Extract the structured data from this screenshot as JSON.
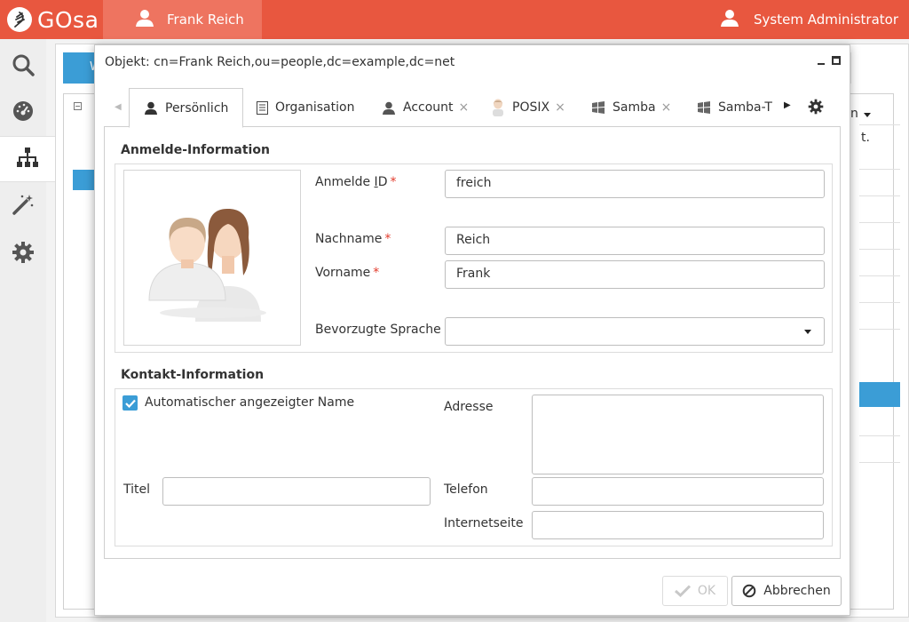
{
  "topbar": {
    "logo_text": "GOsa",
    "current_user": "Frank Reich",
    "admin_user": "System Administrator",
    "color": "#e8573f"
  },
  "sidebar": {
    "items": [
      {
        "name": "search",
        "icon": "search-icon"
      },
      {
        "name": "dashboard",
        "icon": "dashboard-icon"
      },
      {
        "name": "directory",
        "icon": "sitemap-icon",
        "active": true
      },
      {
        "name": "wizard",
        "icon": "magic-wand-icon"
      },
      {
        "name": "settings",
        "icon": "gear-icon"
      }
    ]
  },
  "background": {
    "button_fragment": "W",
    "dropdown_fragment": "n",
    "row_fragment": "t."
  },
  "dialog": {
    "title": "Objekt: cn=Frank Reich,ou=people,dc=example,dc=net",
    "tabs": [
      {
        "label": "Persönlich",
        "icon": "user-icon",
        "active": true,
        "closable": false
      },
      {
        "label": "Organisation",
        "icon": "building-icon",
        "active": false,
        "closable": false
      },
      {
        "label": "Account",
        "icon": "user-icon",
        "active": false,
        "closable": true
      },
      {
        "label": "POSIX",
        "icon": "penguin-icon",
        "active": false,
        "closable": true
      },
      {
        "label": "Samba",
        "icon": "windows-icon",
        "active": false,
        "closable": true
      },
      {
        "label": "Samba-T",
        "icon": "windows-icon",
        "active": false,
        "closable": false
      }
    ],
    "login_section": {
      "title": "Anmelde-Information",
      "login_id_label_pre": "Anmelde ",
      "login_id_label_key": "I",
      "login_id_label_post": "D",
      "login_id_value": "freich",
      "surname_label": "Nachname",
      "surname_value": "Reich",
      "firstname_label": "Vorname",
      "firstname_value": "Frank",
      "language_label": "Bevorzugte Sprache",
      "language_value": "",
      "required_marker": "*"
    },
    "contact_section": {
      "title": "Kontakt-Information",
      "auto_display_name_label": "Automatischer angezeigter Name",
      "auto_display_name_checked": true,
      "title_label": "Titel",
      "title_value": "",
      "address_label": "Adresse",
      "address_value": "",
      "phone_label": "Telefon",
      "phone_value": "",
      "website_label": "Internetseite",
      "website_value": ""
    },
    "buttons": {
      "ok_label": "OK",
      "cancel_label": "Abbrechen"
    }
  },
  "colors": {
    "accent": "#3b9dd6",
    "required": "#e23b2c",
    "topbar": "#e8573f"
  }
}
